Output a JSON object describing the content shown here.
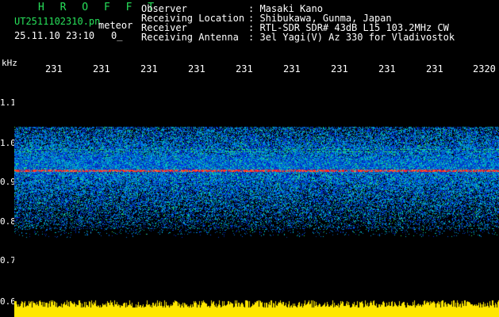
{
  "header": {
    "program_name": "H R O F F T",
    "file_name": "UT2511102310.pn",
    "meteor_label": "meteor",
    "datetime": "25.11.10 23:10",
    "flag": "0_",
    "info": [
      {
        "label": "Observer",
        "value": ": Masaki Kano"
      },
      {
        "label": "Receiving Location",
        "value": ": Shibukawa, Gunma, Japan"
      },
      {
        "label": "Receiver",
        "value": ": RTL-SDR SDR# 43dB L15 103.2MHz CW"
      },
      {
        "label": "Receiving Antenna",
        "value": ": 3el Yagi(V) Az 330 for Vladivostok"
      }
    ]
  },
  "axes": {
    "y_unit": "kHz",
    "y_ticks": [
      "1.1",
      "1.0",
      "0.9",
      "0.8",
      "0.7",
      "0.6"
    ],
    "x_ticks": [
      "231",
      "231",
      "231",
      "231",
      "231",
      "231",
      "231",
      "231",
      "231",
      "2320"
    ]
  },
  "colors": {
    "background": "#000000",
    "label_green": "#27e05a",
    "power_bar": "#ffe800",
    "signal_red": "#ff2020"
  }
}
